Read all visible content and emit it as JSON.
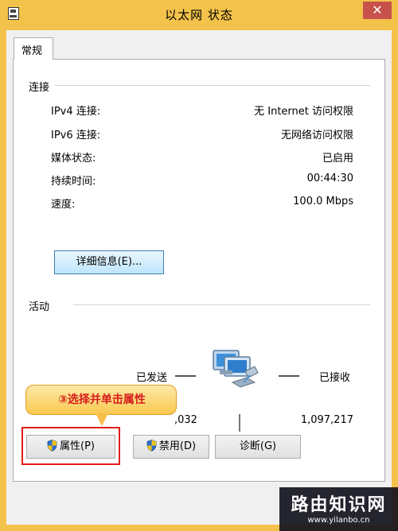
{
  "window": {
    "title": "以太网 状态",
    "close_icon": "close-icon"
  },
  "tab": {
    "general": "常规"
  },
  "connection": {
    "section_title": "连接",
    "rows": [
      {
        "label": "IPv4 连接:",
        "value": "无 Internet 访问权限"
      },
      {
        "label": "IPv6 连接:",
        "value": "无网络访问权限"
      },
      {
        "label": "媒体状态:",
        "value": "已启用"
      },
      {
        "label": "持续时间:",
        "value": "00:44:30"
      },
      {
        "label": "速度:",
        "value": "100.0 Mbps"
      }
    ],
    "details_button": "详细信息(E)..."
  },
  "activity": {
    "section_title": "活动",
    "sent_label": "已发送",
    "received_label": "已接收",
    "sent_value": ",032",
    "received_value": "1,097,217"
  },
  "buttons": {
    "properties": "属性(P)",
    "disable": "禁用(D)",
    "diagnose": "诊断(G)"
  },
  "annotation": {
    "callout_text": "③选择并单击属性"
  },
  "watermark": {
    "title": "路由知识网",
    "url": "www.yilanbo.cn"
  },
  "colors": {
    "frame": "#f3c24a",
    "close": "#c7524b",
    "highlight": "#e11d1d"
  }
}
